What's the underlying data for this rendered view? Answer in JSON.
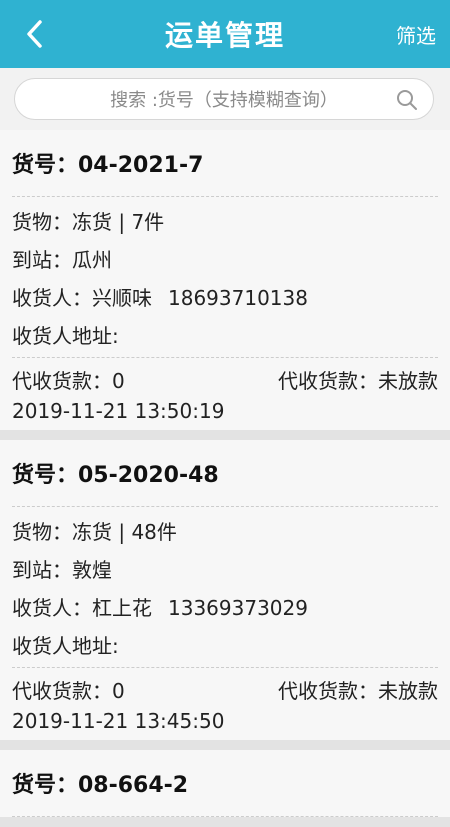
{
  "header": {
    "title": "运单管理",
    "filter_label": "筛选"
  },
  "search": {
    "placeholder": "搜索 :货号（支持模糊查询）"
  },
  "waybills": [
    {
      "number_label": "货号：04-2021-7",
      "goods_line": "货物：冻货 | 7件",
      "station_line": "到站：瓜州",
      "consignee_label": "收货人：",
      "consignee_name": "兴顺味",
      "consignee_phone": "18693710138",
      "address_label": "收货人地址:",
      "cod_amount_label": "代收货款：0",
      "cod_status_label": "代收货款：未放款",
      "time": "2019-11-21 13:50:19"
    },
    {
      "number_label": "货号：05-2020-48",
      "goods_line": "货物：冻货 | 48件",
      "station_line": "到站：敦煌",
      "consignee_label": "收货人：",
      "consignee_name": "杠上花",
      "consignee_phone": "13369373029",
      "address_label": "收货人地址:",
      "cod_amount_label": "代收货款：0",
      "cod_status_label": "代收货款：未放款",
      "time": "2019-11-21 13:45:50"
    },
    {
      "number_label": "货号：08-664-2"
    }
  ],
  "icons": {
    "back": "chevron-left-icon",
    "search": "search-icon"
  },
  "colors": {
    "header_bg": "#2fb2d1",
    "card_bg": "#f7f7f7"
  }
}
